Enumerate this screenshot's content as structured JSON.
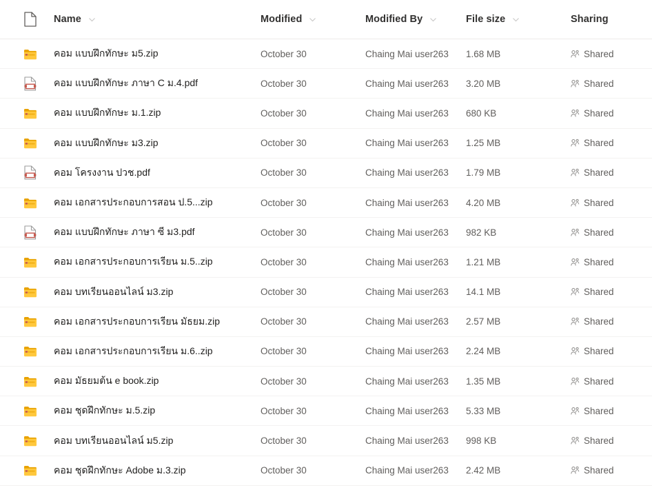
{
  "header": {
    "icon": "document-icon",
    "columns": [
      {
        "label": "Name",
        "sortable": true
      },
      {
        "label": "Modified",
        "sortable": true
      },
      {
        "label": "Modified By",
        "sortable": true
      },
      {
        "label": "File size",
        "sortable": true
      },
      {
        "label": "Sharing",
        "sortable": false
      }
    ]
  },
  "colors": {
    "folder": "#FFC83D",
    "folder_dark": "#E8A200",
    "pdf": "#C4564B",
    "text_primary": "#201f1e",
    "text_secondary": "#605e5c",
    "divider": "#f3f2f1"
  },
  "rows": [
    {
      "icon": "folder-icon",
      "name": "คอม แบบฝึกทักษะ ม5.zip",
      "modified": "October 30",
      "modified_by": "Chaing Mai user263",
      "size": "1.68 MB",
      "sharing": "Shared"
    },
    {
      "icon": "pdf-file-icon",
      "name": "คอม แบบฝึกทักษะ ภาษา C ม.4.pdf",
      "modified": "October 30",
      "modified_by": "Chaing Mai user263",
      "size": "3.20 MB",
      "sharing": "Shared"
    },
    {
      "icon": "folder-icon",
      "name": "คอม แบบฝึกทักษะ ม.1.zip",
      "modified": "October 30",
      "modified_by": "Chaing Mai user263",
      "size": "680 KB",
      "sharing": "Shared"
    },
    {
      "icon": "folder-icon",
      "name": "คอม แบบฝึกทักษะ ม3.zip",
      "modified": "October 30",
      "modified_by": "Chaing Mai user263",
      "size": "1.25 MB",
      "sharing": "Shared"
    },
    {
      "icon": "pdf-file-icon",
      "name": "คอม โครงงาน ปวช.pdf",
      "modified": "October 30",
      "modified_by": "Chaing Mai user263",
      "size": "1.79 MB",
      "sharing": "Shared"
    },
    {
      "icon": "folder-icon",
      "name": "คอม เอกสารประกอบการสอน ป.5...zip",
      "modified": "October 30",
      "modified_by": "Chaing Mai user263",
      "size": "4.20 MB",
      "sharing": "Shared"
    },
    {
      "icon": "pdf-file-icon",
      "name": "คอม แบบฝึกทักษะ ภาษา ซี ม3.pdf",
      "modified": "October 30",
      "modified_by": "Chaing Mai user263",
      "size": "982 KB",
      "sharing": "Shared"
    },
    {
      "icon": "folder-icon",
      "name": "คอม เอกสารประกอบการเรียน ม.5..zip",
      "modified": "October 30",
      "modified_by": "Chaing Mai user263",
      "size": "1.21 MB",
      "sharing": "Shared"
    },
    {
      "icon": "folder-icon",
      "name": "คอม บทเรียนออนไลน์ ม3.zip",
      "modified": "October 30",
      "modified_by": "Chaing Mai user263",
      "size": "14.1 MB",
      "sharing": "Shared"
    },
    {
      "icon": "folder-icon",
      "name": "คอม เอกสารประกอบการเรียน มัธยม.zip",
      "modified": "October 30",
      "modified_by": "Chaing Mai user263",
      "size": "2.57 MB",
      "sharing": "Shared"
    },
    {
      "icon": "folder-icon",
      "name": "คอม เอกสารประกอบการเรียน ม.6..zip",
      "modified": "October 30",
      "modified_by": "Chaing Mai user263",
      "size": "2.24 MB",
      "sharing": "Shared"
    },
    {
      "icon": "folder-icon",
      "name": "คอม มัธยมต้น e book.zip",
      "modified": "October 30",
      "modified_by": "Chaing Mai user263",
      "size": "1.35 MB",
      "sharing": "Shared"
    },
    {
      "icon": "folder-icon",
      "name": "คอม ชุดฝึกทักษะ ม.5.zip",
      "modified": "October 30",
      "modified_by": "Chaing Mai user263",
      "size": "5.33 MB",
      "sharing": "Shared"
    },
    {
      "icon": "folder-icon",
      "name": "คอม บทเรียนออนไลน์ ม5.zip",
      "modified": "October 30",
      "modified_by": "Chaing Mai user263",
      "size": "998 KB",
      "sharing": "Shared"
    },
    {
      "icon": "folder-icon",
      "name": "คอม ชุดฝึกทักษะ Adobe ม.3.zip",
      "modified": "October 30",
      "modified_by": "Chaing Mai user263",
      "size": "2.42 MB",
      "sharing": "Shared"
    }
  ]
}
